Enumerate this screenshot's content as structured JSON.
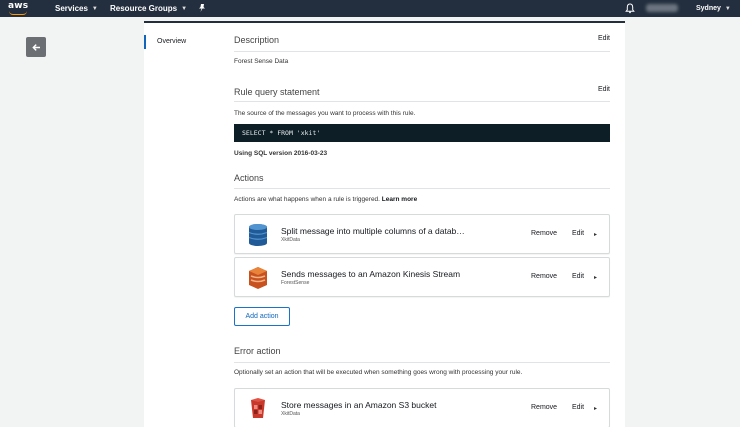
{
  "nav": {
    "logo_text": "aws",
    "services_label": "Services",
    "resource_groups_label": "Resource Groups",
    "region_label": "Sydney"
  },
  "sidebar": {
    "overview_label": "Overview"
  },
  "description": {
    "title": "Description",
    "edit_label": "Edit",
    "value": "Forest Sense Data"
  },
  "rule_query": {
    "title": "Rule query statement",
    "edit_label": "Edit",
    "help_text": "The source of the messages you want to process with this rule.",
    "sql": "SELECT * FROM 'xkit'",
    "sql_version": "Using SQL version 2016-03-23"
  },
  "actions": {
    "title": "Actions",
    "help_text": "Actions are what happens when a rule is triggered.",
    "learn_more_label": "Learn more",
    "items": [
      {
        "title": "Split message into multiple columns of a datab…",
        "subtitle": "XkitData",
        "remove_label": "Remove",
        "edit_label": "Edit",
        "icon": "dynamodb-icon"
      },
      {
        "title": "Sends messages to an Amazon Kinesis Stream",
        "subtitle": "ForestSense",
        "remove_label": "Remove",
        "edit_label": "Edit",
        "icon": "kinesis-icon"
      }
    ],
    "add_label": "Add action"
  },
  "error_action": {
    "title": "Error action",
    "help_text": "Optionally set an action that will be executed when something goes wrong with processing your rule.",
    "items": [
      {
        "title": "Store messages in an Amazon S3 bucket",
        "subtitle": "XkitData",
        "remove_label": "Remove",
        "edit_label": "Edit",
        "icon": "s3-icon"
      }
    ]
  },
  "colors": {
    "nav_bg": "#232f3e",
    "accent": "#ff9900",
    "sql_bg": "#0d1e26",
    "link_blue": "#1166bb"
  }
}
